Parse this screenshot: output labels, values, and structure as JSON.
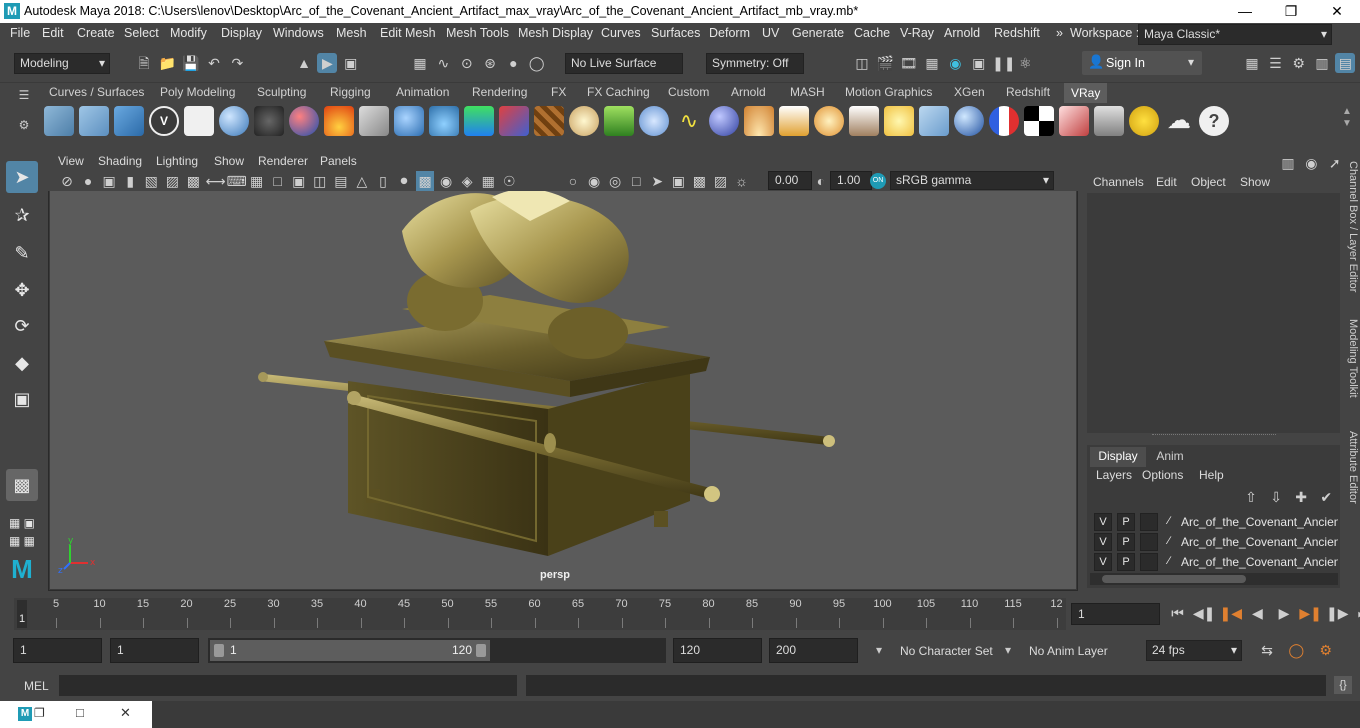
{
  "window": {
    "title": "Autodesk Maya 2018: C:\\Users\\lenov\\Desktop\\Arc_of_the_Covenant_Ancient_Artifact_max_vray\\Arc_of_the_Covenant_Ancient_Artifact_mb_vray.mb*",
    "logo": "M"
  },
  "menubar": {
    "items": [
      "File",
      "Edit",
      "Create",
      "Select",
      "Modify",
      "Display",
      "Windows",
      "Mesh",
      "Edit Mesh",
      "Mesh Tools",
      "Mesh Display",
      "Curves",
      "Surfaces",
      "Deform",
      "UV",
      "Generate",
      "Cache",
      "V-Ray",
      "Arnold",
      "Redshift"
    ],
    "workspace_label": "Workspace :",
    "workspace_value": "Maya Classic*"
  },
  "statusline": {
    "mode": "Modeling",
    "live_surface": "No Live Surface",
    "symmetry": "Symmetry: Off",
    "sign_in": "Sign In"
  },
  "shelf": {
    "tabs": [
      "Curves / Surfaces",
      "Poly Modeling",
      "Sculpting",
      "Rigging",
      "Animation",
      "Rendering",
      "FX",
      "FX Caching",
      "Custom",
      "Arnold",
      "MASH",
      "Motion Graphics",
      "XGen",
      "Redshift",
      "VRay"
    ],
    "active_tab": "VRay"
  },
  "panel": {
    "menus": [
      "View",
      "Shading",
      "Lighting",
      "Show",
      "Renderer",
      "Panels"
    ],
    "exposure": "0.00",
    "gamma": "1.00",
    "color_space": "sRGB gamma",
    "camera": "persp"
  },
  "channelbox": {
    "menus": [
      "Channels",
      "Edit",
      "Object",
      "Show"
    ]
  },
  "layereditor": {
    "tabs": [
      "Display",
      "Anim"
    ],
    "menus": [
      "Layers",
      "Options",
      "Help"
    ],
    "layers": [
      {
        "v": "V",
        "p": "P",
        "name": "Arc_of_the_Covenant_Ancient_"
      },
      {
        "v": "V",
        "p": "P",
        "name": "Arc_of_the_Covenant_Ancient_"
      },
      {
        "v": "V",
        "p": "P",
        "name": "Arc_of_the_Covenant_Ancient_"
      }
    ]
  },
  "sidetabs": [
    "Channel Box / Layer Editor",
    "Modeling Toolkit",
    "Attribute Editor"
  ],
  "timeslider": {
    "start_frame_label": "1",
    "ticks": [
      "5",
      "10",
      "15",
      "20",
      "25",
      "30",
      "35",
      "40",
      "45",
      "50",
      "55",
      "60",
      "65",
      "70",
      "75",
      "80",
      "85",
      "90",
      "95",
      "100",
      "105",
      "110",
      "115",
      "12"
    ],
    "current_frame": "1"
  },
  "rangeslider": {
    "start": "1",
    "playback_start": "1",
    "range_start": "1",
    "range_end": "120",
    "playback_end": "120",
    "end": "200",
    "character_set": "No Character Set",
    "anim_layer": "No Anim Layer",
    "fps": "24 fps"
  },
  "cmdline": {
    "label": "MEL"
  }
}
